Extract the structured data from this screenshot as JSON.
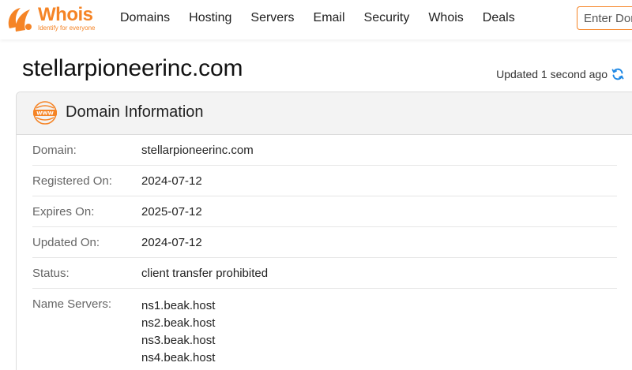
{
  "header": {
    "logo": {
      "word": "Whois",
      "tagline": "Identify for everyone"
    },
    "nav": [
      "Domains",
      "Hosting",
      "Servers",
      "Email",
      "Security",
      "Whois",
      "Deals"
    ],
    "search_placeholder": "Enter Domain or IP"
  },
  "page": {
    "title": "stellarpioneerinc.com",
    "updated": "Updated 1 second ago"
  },
  "card": {
    "title": "Domain Information",
    "icon": "www-icon",
    "rows": [
      {
        "label": "Domain:",
        "value": "stellarpioneerinc.com"
      },
      {
        "label": "Registered On:",
        "value": "2024-07-12"
      },
      {
        "label": "Expires On:",
        "value": "2025-07-12"
      },
      {
        "label": "Updated On:",
        "value": "2024-07-12"
      },
      {
        "label": "Status:",
        "value": "client transfer prohibited"
      }
    ],
    "name_servers": {
      "label": "Name Servers:",
      "values": [
        "ns1.beak.host",
        "ns2.beak.host",
        "ns3.beak.host",
        "ns4.beak.host"
      ]
    }
  },
  "colors": {
    "accent": "#f58426",
    "refresh": "#1e88e5"
  }
}
